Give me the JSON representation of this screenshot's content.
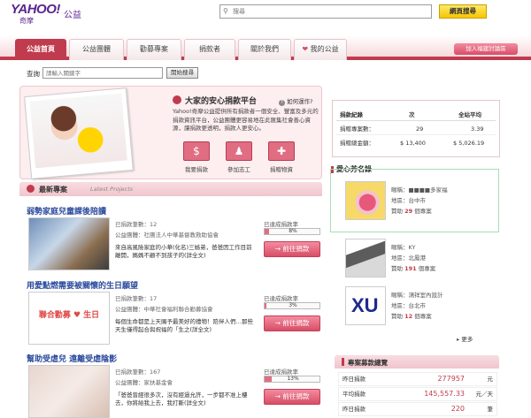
{
  "header": {
    "logo": "YAHOO!",
    "logo_sub": "奇摩",
    "site_name": "公益",
    "search_placeholder": "搜尋",
    "search_button": "網頁搜尋"
  },
  "nav": {
    "tabs": [
      "公益首頁",
      "公益團體",
      "勸募專案",
      "捐款者",
      "關於我們",
      "我的公益"
    ],
    "active_index": 0,
    "fb_button": "加入福建討論區"
  },
  "query": {
    "label": "查詢",
    "placeholder": "請輸入關鍵字",
    "button": "開始搜尋"
  },
  "hero": {
    "title": "大家的安心捐款平台",
    "how_to": "如何運作?",
    "description": "Yahoo!奇摩公益提供所有捐款者一個安全、豐富及多元的捐款資訊平台，公益團體更容易地在此匯集社會善心資源，讓捐款更透明，捐款人更安心。",
    "buttons": [
      {
        "label": "我要捐款",
        "icon": "dollar-icon"
      },
      {
        "label": "參加志工",
        "icon": "volunteer-icon"
      },
      {
        "label": "捐贈物資",
        "icon": "gift-icon"
      }
    ]
  },
  "latest": {
    "title": "最新專案",
    "subtitle": "Latest Projects",
    "projects": [
      {
        "title": "弱勢家庭兒童課後陪讀",
        "donors": "已捐款筆數：12",
        "org": "公益團體：社團法人中華基督教救助協會",
        "desc": "來自高風險家庭的小華(化名)三姊弟，爸爸因工作目前離開，媽媽不顧不到孩子的",
        "desc_more": "(詳全文)",
        "rate_label": "已達成捐款率",
        "rate_text": "8%",
        "rate": 8,
        "button": "前往捐款"
      },
      {
        "title": "用愛點燃需要被關懷的生日願望",
        "donors": "已捐款筆數：17",
        "org": "公益團體：中華社會福利聯合勸募協會",
        "desc": "每個生命都是上天賜予最美好的禮物！陪伴人們…那些天生僅得起合與祝福的「生之",
        "desc_more": "(詳全文)",
        "rate_label": "已達成捐款率",
        "rate_text": "3%",
        "rate": 3,
        "button": "前往捐款"
      },
      {
        "title": "幫助受虐兒 遠離受虐陰影",
        "donors": "已捐款筆數：167",
        "org": "公益團體：家扶基金會",
        "desc": "「爸爸曾經很多次，沒有經過允許，一步都不准上樓去，你將給我上去，我打斷",
        "desc_more": "(詳全文)",
        "rate_label": "已達成捐款率",
        "rate_text": "13%",
        "rate": 13,
        "button": "前往捐款"
      }
    ]
  },
  "stats": {
    "headers": [
      "捐款紀錄",
      "次",
      "全站平均"
    ],
    "rows": [
      {
        "label": "捐贈專案數：",
        "value": "29",
        "avg": "3.39"
      },
      {
        "label": "捐贈總金額：",
        "value": "$ 13,400",
        "avg": "$ 5,026.19"
      }
    ]
  },
  "donors": {
    "title": "愛心芳名錄",
    "items": [
      {
        "name": "暱稱：■■■■多家福",
        "area": "地區：台中市",
        "count_prefix": "贊助",
        "count": "29",
        "count_suffix": "個專案"
      },
      {
        "name": "暱稱：KY",
        "area": "地區：北鳳港",
        "count_prefix": "贊助",
        "count": "191",
        "count_suffix": "個專案"
      },
      {
        "name": "暱稱：鴻祥室內設計",
        "area": "地區：台北市",
        "count_prefix": "贊助",
        "count": "12",
        "count_suffix": "個專案"
      }
    ],
    "more": "更多"
  },
  "fund": {
    "title": "專案募款總覽",
    "rows": [
      {
        "label": "昨日捐款",
        "value": "277957",
        "unit": "元"
      },
      {
        "label": "平均捐款",
        "value": "145,557.33",
        "unit": "元／天"
      },
      {
        "label": "昨日捐款",
        "value": "220",
        "unit": "筆"
      }
    ]
  },
  "colors": {
    "brand": "#c03b4d",
    "yahoo_purple": "#5b2390",
    "link_blue": "#2a4a9c",
    "button_yellow": "#f6c500"
  }
}
